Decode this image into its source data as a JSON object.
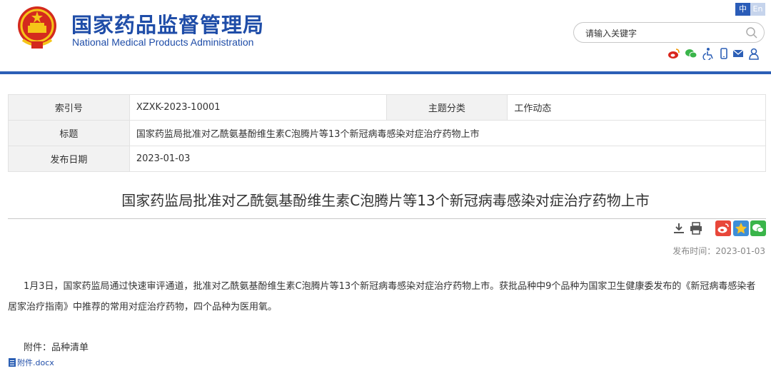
{
  "header": {
    "site_name_cn": "国家药品监督管理局",
    "site_name_en": "National Medical Products Administration",
    "lang_cn": "中",
    "lang_en": "En",
    "search_placeholder": "请输入关键字",
    "icons": [
      "weibo-icon",
      "wechat-icon",
      "accessibility-icon",
      "mobile-icon",
      "mail-icon",
      "user-icon"
    ],
    "brand_color": "#1f4da8"
  },
  "meta": {
    "index_label": "索引号",
    "index_value": "XZXK-2023-10001",
    "category_label": "主题分类",
    "category_value": "工作动态",
    "title_label": "标题",
    "title_value": "国家药监局批准对乙酰氨基酚维生素C泡腾片等13个新冠病毒感染对症治疗药物上市",
    "date_label": "发布日期",
    "date_value": "2023-01-03"
  },
  "article": {
    "title": "国家药监局批准对乙酰氨基酚维生素C泡腾片等13个新冠病毒感染对症治疗药物上市",
    "publish_time": "发布时间：2023-01-03",
    "body": "1月3日，国家药监局通过快速审评通道，批准对乙酰氨基酚维生素C泡腾片等13个新冠病毒感染对症治疗药物上市。获批品种中9个品种为国家卫生健康委发布的《新冠病毒感染者居家治疗指南》中推荐的常用对症治疗药物，四个品种为医用氧。",
    "attachment_label": "附件：品种清单",
    "attachment_file": "附件.docx"
  }
}
